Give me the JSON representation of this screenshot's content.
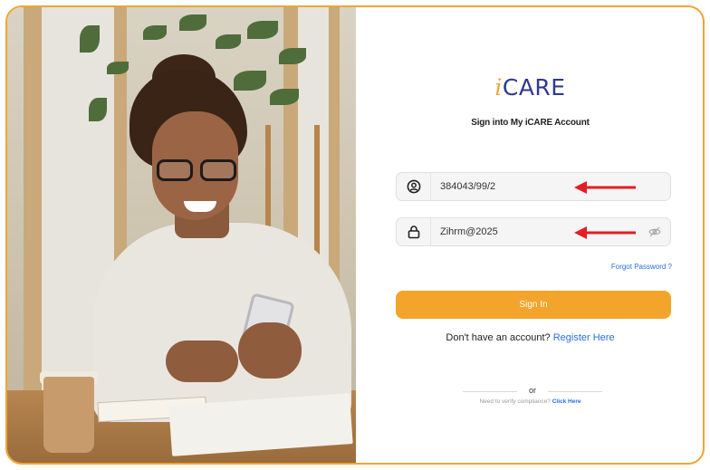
{
  "brand": {
    "prefix": "i",
    "name": "CARE"
  },
  "subtitle": "Sign into My iCARE Account",
  "username": {
    "value": "384043/99/2",
    "icon": "user-circle-icon"
  },
  "password": {
    "value": "Zihrm@2025",
    "icon": "lock-icon",
    "toggle_icon": "eye-off-icon"
  },
  "annotation": {
    "arrow_color": "#e31e24",
    "icon": "red-arrow-icon"
  },
  "forgot_password": "Forgot Password ?",
  "sign_in_button": "Sign In",
  "register": {
    "prompt": "Don't have an account?",
    "link": "Register Here"
  },
  "divider": "or",
  "verify": {
    "prompt": "Need to verify compliance?",
    "link": "Click Here"
  },
  "colors": {
    "accent": "#f3a42b",
    "brand_blue": "#2f3a8f",
    "link_blue": "#2a6fdb",
    "frame": "#f0a534"
  }
}
